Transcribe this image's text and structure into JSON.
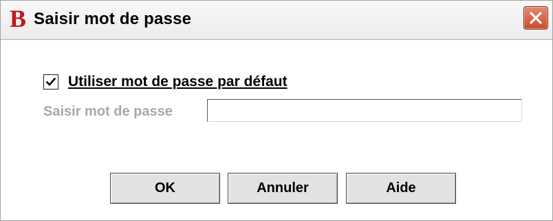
{
  "window": {
    "title": "Saisir mot de passe",
    "app_icon_letter": "B",
    "app_icon_color": "#c01818",
    "close_icon": "close-icon"
  },
  "form": {
    "default_password_checkbox": {
      "label": "Utiliser mot de passe par défaut",
      "checked": true
    },
    "password_field": {
      "label": "Saisir mot de passe",
      "value": "",
      "disabled": true
    }
  },
  "buttons": {
    "ok_label": "OK",
    "cancel_label": "Annuler",
    "help_label": "Aide"
  }
}
